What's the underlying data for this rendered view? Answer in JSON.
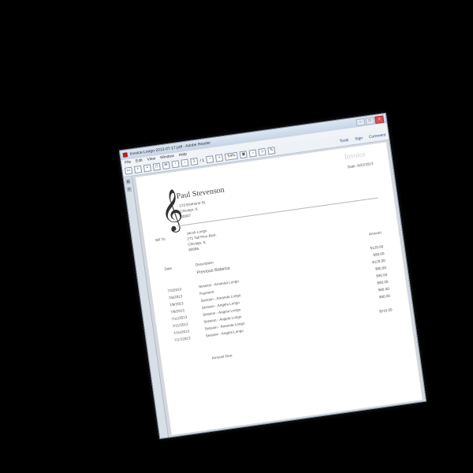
{
  "window": {
    "title": "Invoice-Longo-2013-07-17.pdf - Adobe Reader",
    "controls": [
      "–",
      "□",
      "×"
    ]
  },
  "menubar": {
    "items": [
      "File",
      "Edit",
      "View",
      "Window",
      "Help"
    ]
  },
  "toolbar": {
    "page_current": "1",
    "page_total": "/ 1",
    "zoom": "54%",
    "right_links": [
      "Tools",
      "Sign",
      "Comment"
    ]
  },
  "invoice": {
    "title": "Invoice",
    "date": "Date: 9/22/2013",
    "clef_symbol": "𝄞",
    "company": {
      "name": "Paul Stevenson",
      "address": [
        "123 Elmhurst St.",
        "Chicago, IL",
        "60607"
      ]
    },
    "bill_to": {
      "label": "Bill To:",
      "address": [
        "Jacob Longo",
        "275 Tall Pine Blvd.",
        "Chicago, IL",
        "60586"
      ]
    },
    "columns": {
      "date": "Date",
      "description": "Description",
      "amount": "Amount"
    },
    "rows": [
      {
        "date": "",
        "description": "Previous Balance",
        "amount": "$120.00",
        "style": "prev"
      },
      {
        "date": "",
        "description": "",
        "amount": "$90.00",
        "style": ""
      },
      {
        "date": "7/3/2013",
        "description": "Session - Amanda Longo",
        "amount": "$120.00",
        "style": ""
      },
      {
        "date": "7/6/2013",
        "description": "Payment",
        "amount": "$90.00",
        "style": ""
      },
      {
        "date": "7/9/2013",
        "description": "Session - Amanda Longo",
        "amount": "$90.00",
        "style": ""
      },
      {
        "date": "7/9/2013",
        "description": "Session - Angela Longo",
        "amount": "$90.00",
        "style": ""
      },
      {
        "date": "7/11/2013",
        "description": "Session - Angela Longo",
        "amount": "$90.00",
        "style": ""
      },
      {
        "date": "7/11/2013",
        "description": "Session - Angela Longo",
        "amount": "$90.00",
        "style": ""
      },
      {
        "date": "7/15/2013",
        "description": "Session - Amanda Longo",
        "amount": "",
        "style": ""
      },
      {
        "date": "7/17/2013",
        "description": "Session - Angela Longo",
        "amount": "$210.00",
        "style": ""
      }
    ],
    "amount_due_label": "Amount Due:",
    "amount_due_value": ""
  }
}
